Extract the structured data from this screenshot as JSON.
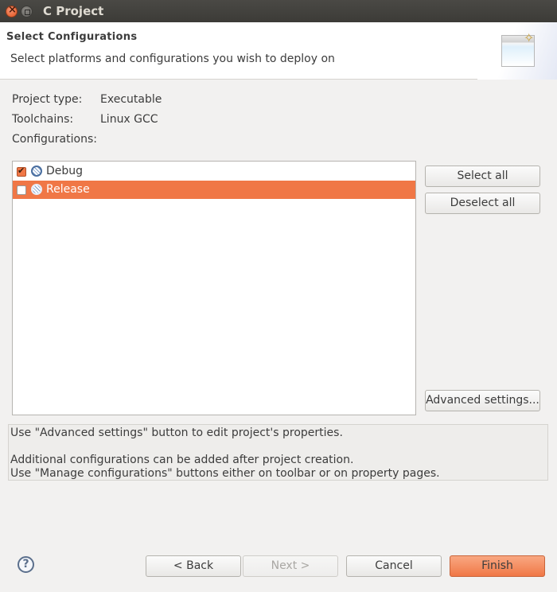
{
  "window": {
    "title": "C Project"
  },
  "header": {
    "title": "Select Configurations",
    "description": "Select platforms and configurations you wish to deploy on",
    "icon": "wizard-banner-icon"
  },
  "project": {
    "type_label": "Project type:",
    "type_value": "Executable",
    "toolchains_label": "Toolchains:",
    "toolchains_value": "Linux GCC",
    "configurations_label": "Configurations:"
  },
  "configurations": [
    {
      "label": "Debug",
      "checked": true,
      "selected": false,
      "icon": "configuration-icon"
    },
    {
      "label": "Release",
      "checked": false,
      "selected": true,
      "icon": "configuration-icon"
    }
  ],
  "buttons": {
    "select_all": "Select all",
    "deselect_all": "Deselect all",
    "advanced_settings": "Advanced settings...",
    "back": "< Back",
    "next": "Next >",
    "cancel": "Cancel",
    "finish": "Finish",
    "help": "?"
  },
  "info": {
    "line1": "Use \"Advanced settings\" button to edit project's properties.",
    "line2": "Additional configurations can be added after project creation.",
    "line3": "Use \"Manage configurations\" buttons either on toolbar or on property pages."
  },
  "colors": {
    "accent": "#f07746",
    "titlebar": "#3c3b37"
  }
}
